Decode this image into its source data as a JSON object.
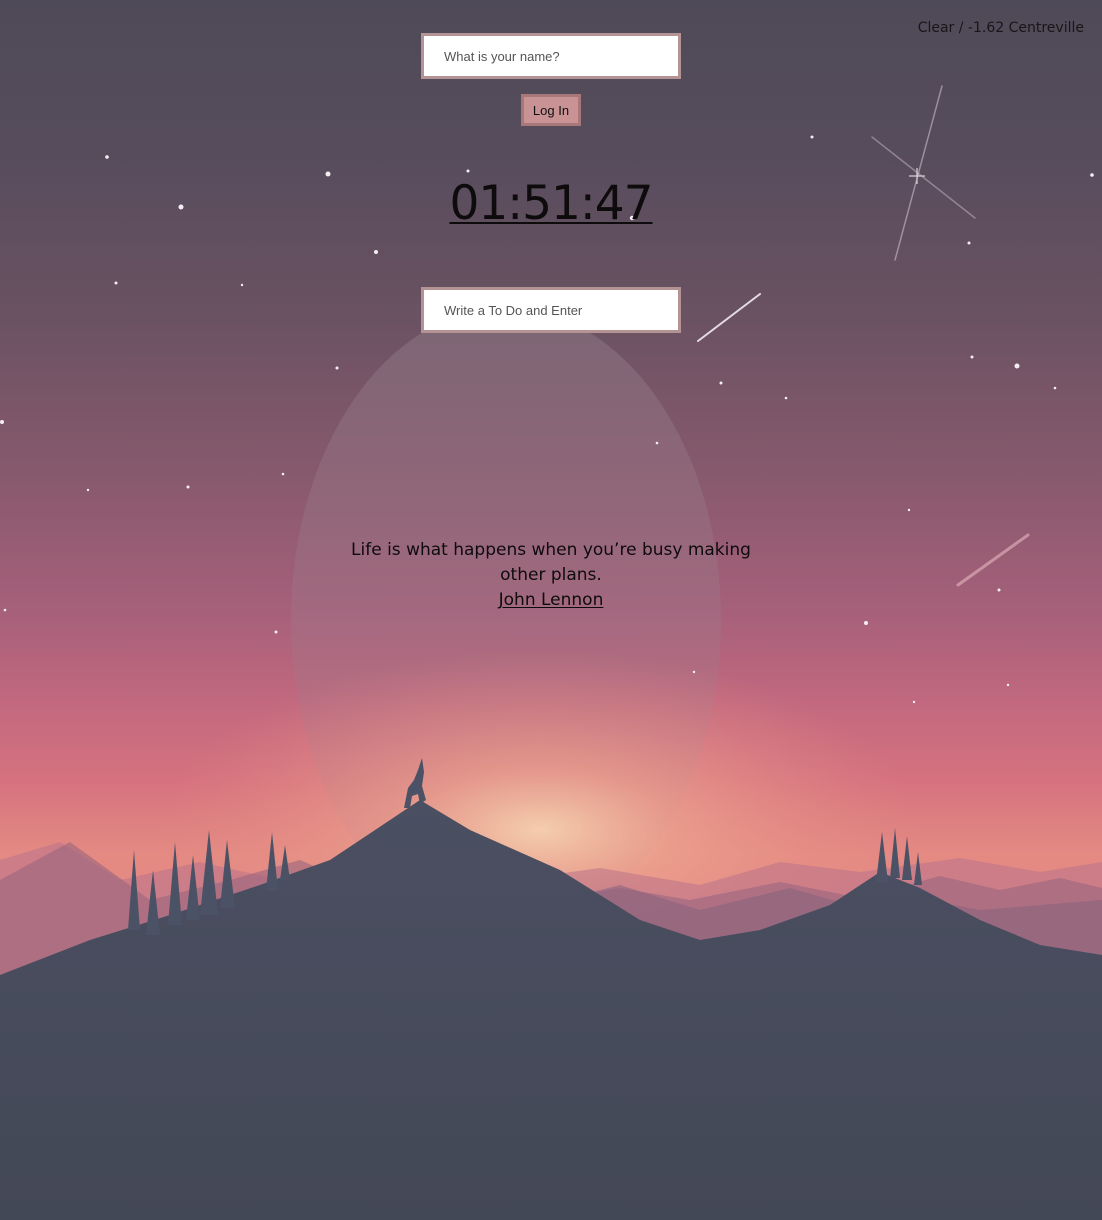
{
  "weather": {
    "text": "Clear / -1.62 Centreville"
  },
  "login": {
    "name_placeholder": "What is your name?",
    "button_label": "Log In"
  },
  "clock": {
    "time": "01:51:47"
  },
  "todo": {
    "placeholder": "Write a To Do and Enter"
  },
  "quote": {
    "text": "Life is what happens when you’re busy making other plans.",
    "author": "John Lennon"
  },
  "colors": {
    "input_border": "#b49395",
    "button_bg": "#c99294",
    "button_border": "#a7777a",
    "sky_top": "#4f4a58",
    "sky_glow": "#e48a83",
    "mountain": "#454a5a"
  },
  "background": {
    "icons": [
      "moon-icon",
      "star-icon",
      "shooting-star-icon",
      "wolf-icon",
      "pine-tree-icon"
    ]
  }
}
